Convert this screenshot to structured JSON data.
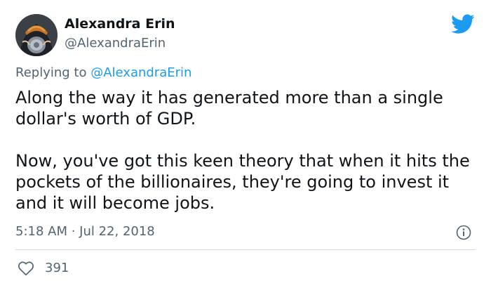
{
  "author": {
    "name": "Alexandra Erin",
    "handle": "@AlexandraErin"
  },
  "reply": {
    "prefix": "Replying to",
    "mention": "@AlexandraErin"
  },
  "tweet": {
    "paragraphs": [
      "Along the way it has generated more than a single dollar's worth of GDP.",
      "Now, you've got this keen theory that when it hits the pockets of the billionaires, they're going to invest it and it will become jobs."
    ],
    "timestamp": "5:18 AM · Jul 22, 2018",
    "likes": "391"
  },
  "icons": {
    "brand": "twitter-bird-icon",
    "info": "info-icon",
    "like": "heart-icon"
  },
  "colors": {
    "brand_blue": "#1d9bf0",
    "text_primary": "#0f1419",
    "text_secondary": "#536471",
    "divider": "#cfd9de"
  }
}
